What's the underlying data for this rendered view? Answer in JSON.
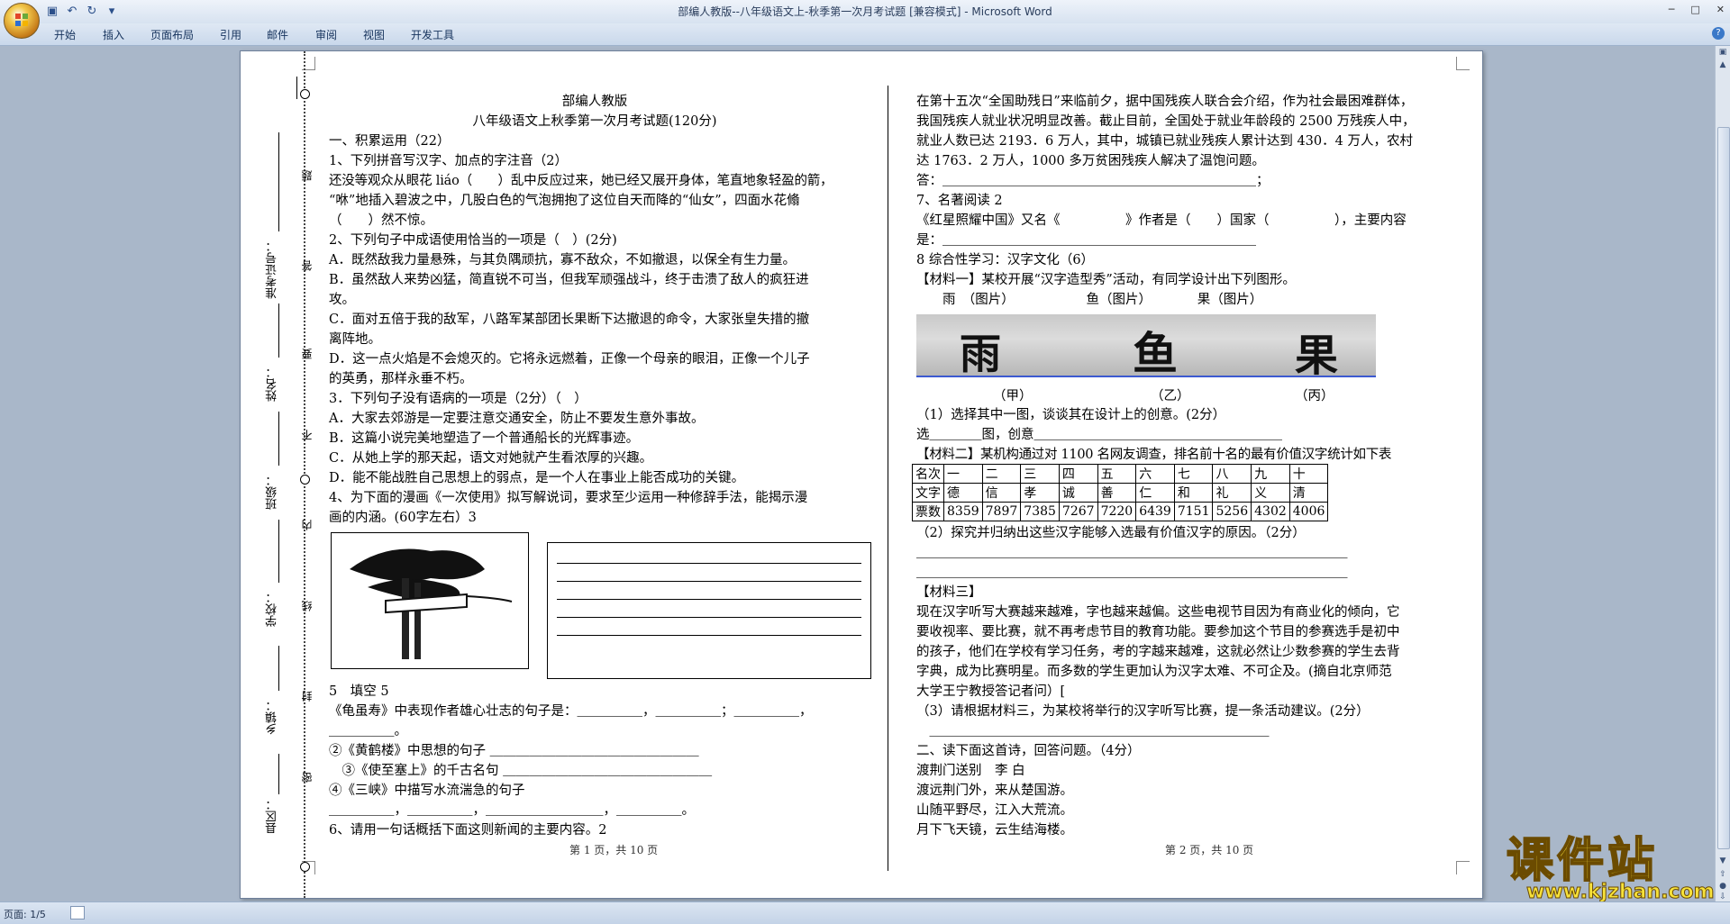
{
  "window": {
    "title": "部编人教版--八年级语文上-秋季第一次月考试题 [兼容模式] - Microsoft Word",
    "controls": [
      "─",
      "□",
      "✕"
    ]
  },
  "ribbon": {
    "tabs": [
      "开始",
      "插入",
      "页面布局",
      "引用",
      "邮件",
      "审阅",
      "视图",
      "开发工具"
    ],
    "help": "?"
  },
  "statusbar": {
    "page": "页面: 1/5"
  },
  "binding": {
    "labels": [
      "准考证号：",
      "姓名：",
      "班级：",
      "学校：",
      "乡镇：",
      "县区："
    ],
    "marks": [
      "题",
      "答",
      "要",
      "不",
      "内",
      "线",
      "封",
      "密"
    ]
  },
  "col1": {
    "title1": "部编人教版",
    "title2": "八年级语文上秋季第一次月考试题(120分)",
    "lines": [
      "一、积累运用（22）",
      "1、下列拼音写汉字、加点的字注音（2）",
      "还没等观众从眼花 liáo（　　）乱中反应过来，她已经又展开身体，笔直地象轻盈的箭，",
      "“咻”地插入碧波之中，几股白色的气泡拥抱了这位自天而降的“仙女”，四面水花翛",
      "（　　）然不惊。",
      "2、下列句子中成语使用恰当的一项是（　）(2分)",
      "A．既然敌我力量悬殊，与其负隅顽抗，寡不敌众，不如撤退，以保全有生力量。",
      "B．虽然敌人来势凶猛，简直锐不可当，但我军顽强战斗，终于击溃了敌人的疯狂进",
      "攻。",
      "C．面对五倍于我的敌军，八路军某部团长果断下达撤退的命令，大家张皇失措的撤",
      "离阵地。",
      "D．这一点火焰是不会熄灭的。它将永远燃着，正像一个母亲的眼泪，正像一个儿子",
      "的英勇，那样永垂不朽。",
      "3．下列句子没有语病的一项是（2分）（　）",
      "A．大家去郊游是一定要注意交通安全，防止不要发生意外事故。",
      "B．这篇小说完美地塑造了一个普通船长的光辉事迹。",
      "C．从她上学的那天起，语文对她就产生看浓厚的兴趣。",
      "D．能不能战胜自己思想上的弱点，是一个人在事业上能否成功的关键。",
      "4、为下面的漫画《一次使用》拟写解说词，要求至少运用一种修辞手法，能揭示漫",
      "画的内涵。(60字左右）3"
    ],
    "lines2": [
      "5　填空 5",
      "《龟虽寿》中表现作者雄心壮志的句子是：＿＿＿＿＿，＿＿＿＿＿；＿＿＿＿＿，",
      "＿＿＿＿＿。",
      "②《黄鹤楼》中思想的句子 ＿＿＿＿＿＿＿＿＿＿＿＿＿＿＿＿",
      "　③《使至塞上》的千古名句 ＿＿＿＿＿＿＿＿＿＿＿＿＿＿＿＿",
      "④《三峡》中描写水流湍急的句子",
      "＿＿＿＿＿，＿＿＿＿＿，＿＿＿＿＿＿＿＿＿，＿＿＿＿＿。",
      "6、请用一句话概括下面这则新闻的主要内容。2"
    ],
    "footer": "第 1 页，共 10 页"
  },
  "col2": {
    "lines": [
      "在第十五次“全国助残日”来临前夕，据中国残疾人联合会介绍，作为社会最困难群体，",
      "我国残疾人就业状况明显改善。截止目前，全国处于就业年龄段的 2500 万残疾人中，",
      "就业人数已达 2193．6 万人，其中，城镇已就业残疾人累计达到 430．4 万人，农村",
      "达 1763．2 万人，1000 多万贫困残疾人解决了温饱问题。",
      "答：＿＿＿＿＿＿＿＿＿＿＿＿＿＿＿＿＿＿＿＿＿＿＿＿；",
      "7、名著阅读 2",
      "《红星照耀中国》又名《　　　　　》作者是（　　）国家（　　　　　），主要内容",
      "是：＿＿＿＿＿＿＿＿＿＿＿＿＿＿＿＿＿＿＿＿＿＿＿＿",
      "8 综合性学习：汉字文化（6）",
      "【材料一】某校开展“汉字造型秀”活动，有同学设计出下列图形。",
      "　　雨　（图片）　　　　　　鱼（图片）　　　　果（图片）"
    ],
    "img_labels": [
      "（甲）",
      "（乙）",
      "（丙）"
    ],
    "img_glyphs": [
      "雨",
      "鱼",
      "果"
    ],
    "lines2": [
      "（1）选择其中一图，谈谈其在设计上的创意。(2分）",
      "选＿＿＿＿图，创意＿＿＿＿＿＿＿＿＿＿＿＿＿＿＿＿＿＿＿",
      "【材料二】某机构通过对 1100 名网友调查，排名前十名的最有价值汉字统计如下表"
    ],
    "table": {
      "headers": [
        "名次",
        "一",
        "二",
        "三",
        "四",
        "五",
        "六",
        "七",
        "八",
        "九",
        "十"
      ],
      "chars": [
        "文字",
        "德",
        "信",
        "孝",
        "诚",
        "善",
        "仁",
        "和",
        "礼",
        "义",
        "清"
      ],
      "votes": [
        "票数",
        "8359",
        "7897",
        "7385",
        "7267",
        "7220",
        "6439",
        "7151",
        "5256",
        "4302",
        "4006"
      ]
    },
    "lines3": [
      "（2）探究并归纳出这些汉字能够入选最有价值汉字的原因。（2分）",
      "＿＿＿＿＿＿＿＿＿＿＿＿＿＿＿＿＿＿＿＿＿＿＿＿＿＿＿＿＿＿＿＿＿",
      "＿＿＿＿＿＿＿＿＿＿＿＿＿＿＿＿＿＿＿＿＿＿＿＿＿＿＿＿＿＿＿＿＿",
      "【材料三】",
      "现在汉字听写大赛越来越难，字也越来越偏。这些电视节目因为有商业化的倾向，它",
      "要收视率、要比赛，就不再考虑节目的教育功能。要参加这个节目的参赛选手是初中",
      "的孩子，他们在学校有学习任务，考的字越来越难，这就必然让少数参赛的学生去背",
      "字典，成为比赛明星。而多数的学生更加认为汉字太难、不可企及。(摘自北京师范",
      "大学王宁教授答记者问）[",
      "（3）请根据材料三，为某校将举行的汉字听写比赛，提一条活动建议。(2分）",
      "　＿＿＿＿＿＿＿＿＿＿＿＿＿＿＿＿＿＿＿＿＿＿＿＿＿＿",
      "二、读下面这首诗，回答问题。（4分）",
      "渡荆门送别　李 白",
      "渡远荆门外，来从楚国游。",
      "山随平野尽，江入大荒流。",
      "月下飞天镜，云生结海楼。"
    ],
    "footer": "第 2 页，共 10 页"
  },
  "watermark": {
    "big": "课件站",
    "url": "www.kjzhan.com"
  }
}
